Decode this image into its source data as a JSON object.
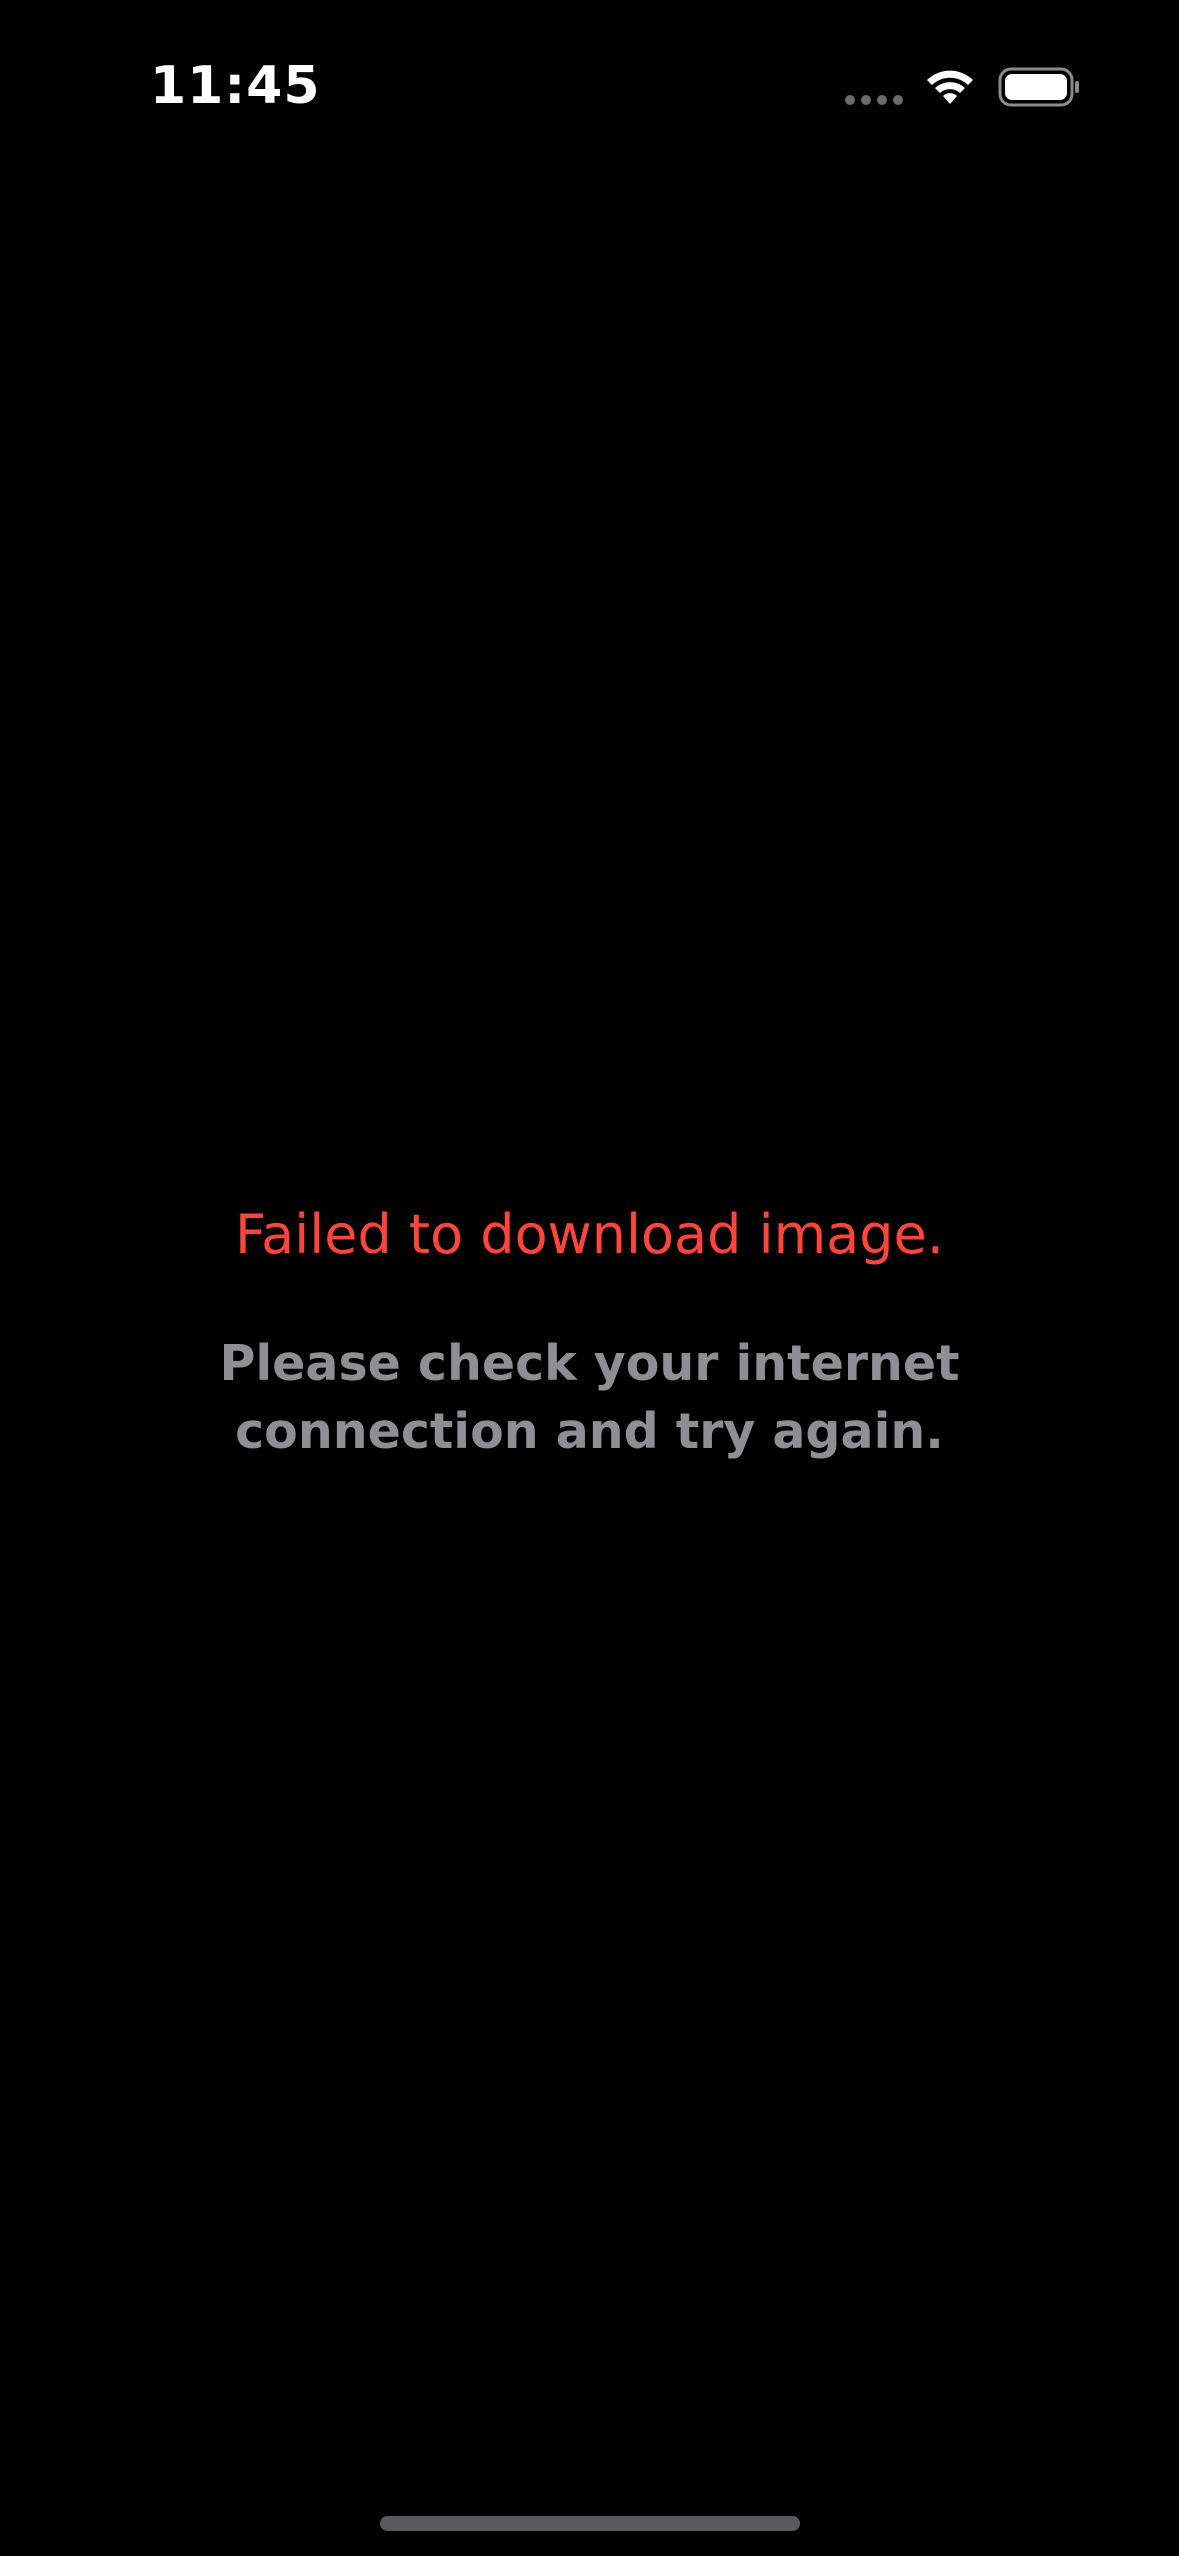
{
  "status_bar": {
    "time": "11:45",
    "cell_icon": "cellular-signal-icon",
    "wifi_icon": "wifi-icon",
    "battery_icon": "battery-icon"
  },
  "error": {
    "title": "Failed to download image.",
    "detail": "Please check your internet connection and try again."
  },
  "colors": {
    "background": "#000000",
    "error_title": "#ff453a",
    "detail_text": "#8e8e93",
    "home_indicator": "#5a5a5e"
  }
}
